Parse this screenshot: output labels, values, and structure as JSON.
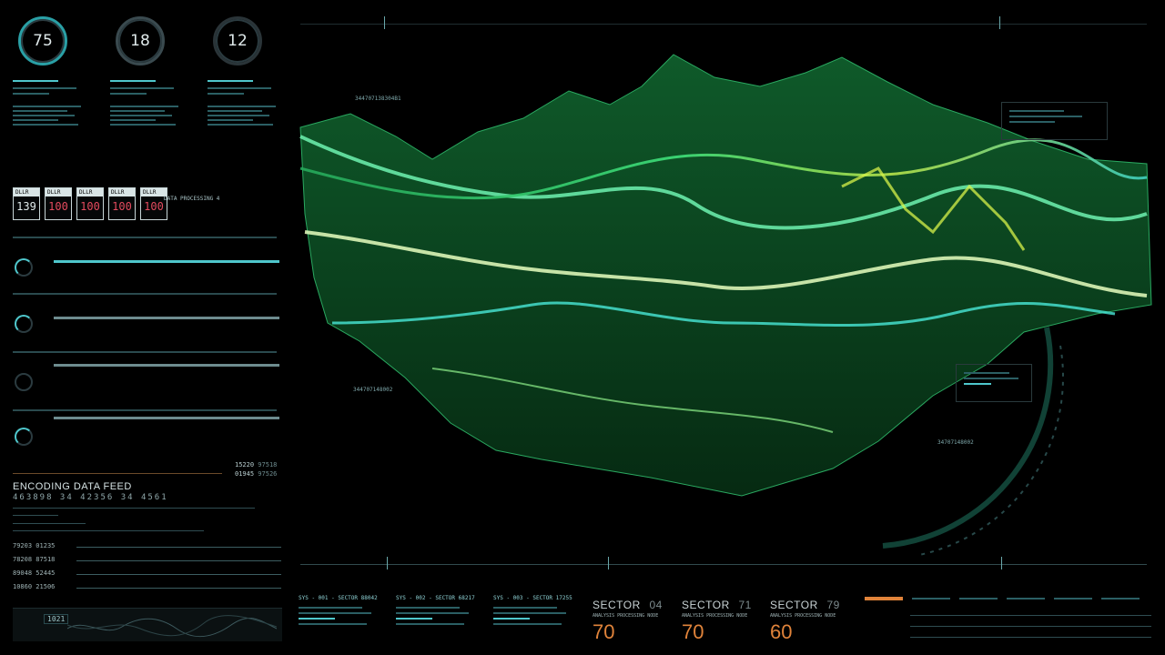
{
  "gauges": [
    {
      "value": "75"
    },
    {
      "value": "18"
    },
    {
      "value": "12"
    }
  ],
  "cards": [
    {
      "top": "DLLR",
      "value": "139"
    },
    {
      "top": "DLLR",
      "value": "100"
    },
    {
      "top": "DLLR",
      "value": "100"
    },
    {
      "top": "DLLR",
      "value": "100"
    },
    {
      "top": "DLLR",
      "value": "100"
    }
  ],
  "data_processing_label": "DATA PROCESSING 4",
  "counter_rows": [
    {
      "a": "15220",
      "b": "97518"
    },
    {
      "a": "01945",
      "b": "97526"
    }
  ],
  "encoding": {
    "title": "ENCODING DATA FEED",
    "numbers": "463898 34 42356 34 4561"
  },
  "feed_rows": [
    {
      "a": "79203",
      "b": "01235"
    },
    {
      "a": "78208",
      "b": "87518"
    },
    {
      "a": "89048",
      "b": "52445"
    },
    {
      "a": "10860",
      "b": "21506"
    }
  ],
  "ids": {
    "top_id": "344707138304B1",
    "mid_id": "344707148002",
    "right_id": "34707148002"
  },
  "sys_panels": [
    {
      "label": "SYS - 001 - SECTOR 88042"
    },
    {
      "label": "SYS - 002 - SECTOR 68217"
    },
    {
      "label": "SYS - 003 - SECTOR 17255"
    }
  ],
  "sectors": [
    {
      "title": "SECTOR",
      "num": "04",
      "sub": "ANALYSIS PROCESSING NODE",
      "big": "70"
    },
    {
      "title": "SECTOR",
      "num": "71",
      "sub": "ANALYSIS PROCESSING NODE",
      "big": "70"
    },
    {
      "title": "SECTOR",
      "num": "79",
      "sub": "ANALYSIS PROCESSING NODE",
      "big": "60"
    }
  ],
  "bottom_left_code": "1021",
  "colors": {
    "accent": "#4fc7cc",
    "terrain_green": "#39d86a",
    "terrain_yellow": "#c8e84a",
    "terrain_cyan": "#38e0d0",
    "alert_red": "#e44a5e",
    "orange": "#e0833a"
  }
}
